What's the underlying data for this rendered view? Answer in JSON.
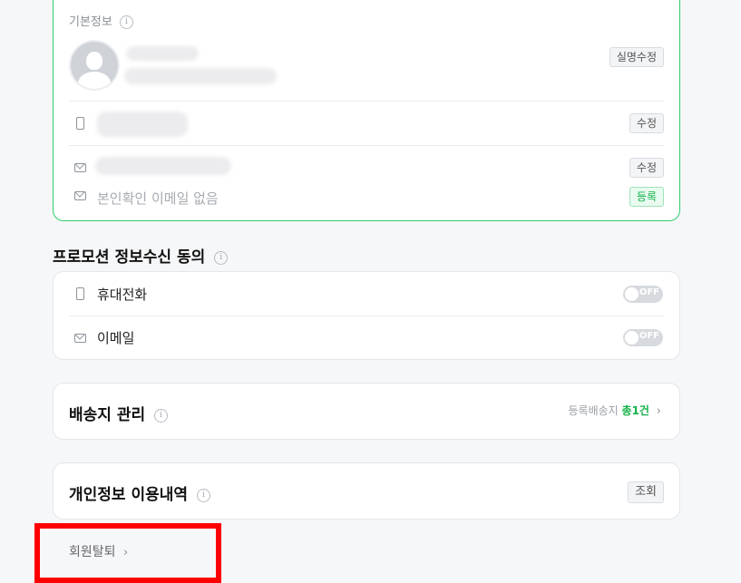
{
  "basic_info": {
    "title": "기본정보",
    "real_name_edit": "실명수정",
    "phone_edit": "수정",
    "email_edit": "수정",
    "verify_email_text": "본인확인 이메일 없음",
    "verify_email_register": "등록"
  },
  "promotion": {
    "title": "프로모션 정보수신 동의",
    "items": [
      {
        "label": "휴대전화",
        "state": "OFF"
      },
      {
        "label": "이메일",
        "state": "OFF"
      }
    ]
  },
  "shipping": {
    "title": "배송지 관리",
    "registered_label": "등록배송지",
    "count": "총1건"
  },
  "privacy": {
    "title": "개인정보 이용내역",
    "view_button": "조회"
  },
  "withdraw": {
    "label": "회원탈퇴"
  },
  "colors": {
    "accent_green": "#14b24a",
    "card_border_active": "#2fce6e",
    "highlight_red": "#ff0000"
  }
}
